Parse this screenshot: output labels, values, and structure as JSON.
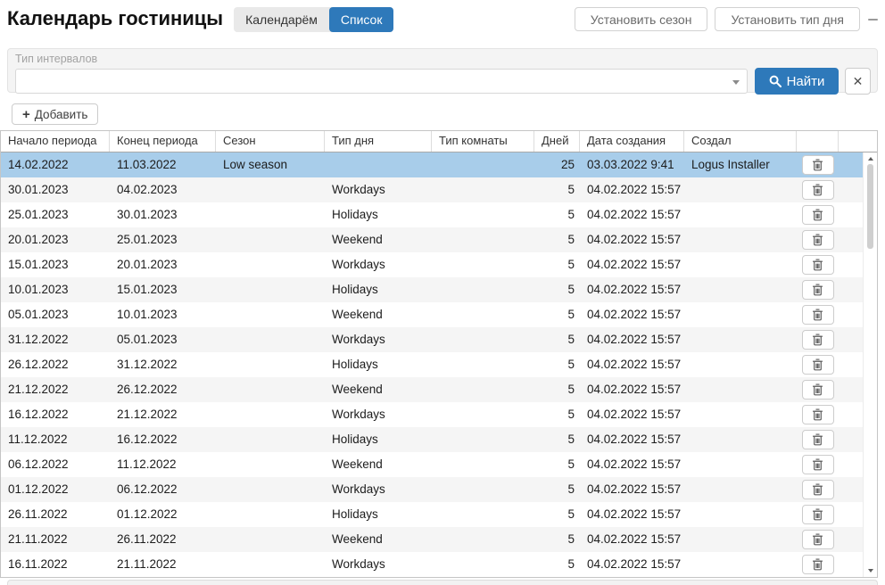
{
  "page": {
    "title": "Календарь гостиницы"
  },
  "view_toggle": {
    "items": [
      {
        "label": "Календарём",
        "active": false
      },
      {
        "label": "Список",
        "active": true
      }
    ]
  },
  "header_actions": {
    "set_season_label": "Установить сезон",
    "set_day_type_label": "Установить тип дня"
  },
  "filter": {
    "label": "Тип интервалов",
    "value": "",
    "find_label": "Найти",
    "clear_glyph": "✕"
  },
  "toolbar": {
    "add_label": "Добавить",
    "plus_glyph": "+"
  },
  "table": {
    "columns": [
      "Начало периода",
      "Конец периода",
      "Сезон",
      "Тип дня",
      "Тип комнаты",
      "Дней",
      "Дата создания",
      "Создал"
    ],
    "rows": [
      {
        "start": "14.02.2022",
        "end": "11.03.2022",
        "season": "Low season",
        "day_type": "",
        "room_type": "",
        "days": "25",
        "created_at": "03.03.2022 9:41",
        "created_by": "Logus Installer",
        "selected": true
      },
      {
        "start": "30.01.2023",
        "end": "04.02.2023",
        "season": "",
        "day_type": "Workdays",
        "room_type": "",
        "days": "5",
        "created_at": "04.02.2022 15:57",
        "created_by": "",
        "selected": false
      },
      {
        "start": "25.01.2023",
        "end": "30.01.2023",
        "season": "",
        "day_type": "Holidays",
        "room_type": "",
        "days": "5",
        "created_at": "04.02.2022 15:57",
        "created_by": "",
        "selected": false
      },
      {
        "start": "20.01.2023",
        "end": "25.01.2023",
        "season": "",
        "day_type": "Weekend",
        "room_type": "",
        "days": "5",
        "created_at": "04.02.2022 15:57",
        "created_by": "",
        "selected": false
      },
      {
        "start": "15.01.2023",
        "end": "20.01.2023",
        "season": "",
        "day_type": "Workdays",
        "room_type": "",
        "days": "5",
        "created_at": "04.02.2022 15:57",
        "created_by": "",
        "selected": false
      },
      {
        "start": "10.01.2023",
        "end": "15.01.2023",
        "season": "",
        "day_type": "Holidays",
        "room_type": "",
        "days": "5",
        "created_at": "04.02.2022 15:57",
        "created_by": "",
        "selected": false
      },
      {
        "start": "05.01.2023",
        "end": "10.01.2023",
        "season": "",
        "day_type": "Weekend",
        "room_type": "",
        "days": "5",
        "created_at": "04.02.2022 15:57",
        "created_by": "",
        "selected": false
      },
      {
        "start": "31.12.2022",
        "end": "05.01.2023",
        "season": "",
        "day_type": "Workdays",
        "room_type": "",
        "days": "5",
        "created_at": "04.02.2022 15:57",
        "created_by": "",
        "selected": false
      },
      {
        "start": "26.12.2022",
        "end": "31.12.2022",
        "season": "",
        "day_type": "Holidays",
        "room_type": "",
        "days": "5",
        "created_at": "04.02.2022 15:57",
        "created_by": "",
        "selected": false
      },
      {
        "start": "21.12.2022",
        "end": "26.12.2022",
        "season": "",
        "day_type": "Weekend",
        "room_type": "",
        "days": "5",
        "created_at": "04.02.2022 15:57",
        "created_by": "",
        "selected": false
      },
      {
        "start": "16.12.2022",
        "end": "21.12.2022",
        "season": "",
        "day_type": "Workdays",
        "room_type": "",
        "days": "5",
        "created_at": "04.02.2022 15:57",
        "created_by": "",
        "selected": false
      },
      {
        "start": "11.12.2022",
        "end": "16.12.2022",
        "season": "",
        "day_type": "Holidays",
        "room_type": "",
        "days": "5",
        "created_at": "04.02.2022 15:57",
        "created_by": "",
        "selected": false
      },
      {
        "start": "06.12.2022",
        "end": "11.12.2022",
        "season": "",
        "day_type": "Weekend",
        "room_type": "",
        "days": "5",
        "created_at": "04.02.2022 15:57",
        "created_by": "",
        "selected": false
      },
      {
        "start": "01.12.2022",
        "end": "06.12.2022",
        "season": "",
        "day_type": "Workdays",
        "room_type": "",
        "days": "5",
        "created_at": "04.02.2022 15:57",
        "created_by": "",
        "selected": false
      },
      {
        "start": "26.11.2022",
        "end": "01.12.2022",
        "season": "",
        "day_type": "Holidays",
        "room_type": "",
        "days": "5",
        "created_at": "04.02.2022 15:57",
        "created_by": "",
        "selected": false
      },
      {
        "start": "21.11.2022",
        "end": "26.11.2022",
        "season": "",
        "day_type": "Weekend",
        "room_type": "",
        "days": "5",
        "created_at": "04.02.2022 15:57",
        "created_by": "",
        "selected": false
      },
      {
        "start": "16.11.2022",
        "end": "21.11.2022",
        "season": "",
        "day_type": "Workdays",
        "room_type": "",
        "days": "5",
        "created_at": "04.02.2022 15:57",
        "created_by": "",
        "selected": false
      }
    ]
  },
  "colors": {
    "accent_blue": "#2e79ba",
    "selected_row": "#a8cdea",
    "stripe": "#f5f5f5"
  }
}
